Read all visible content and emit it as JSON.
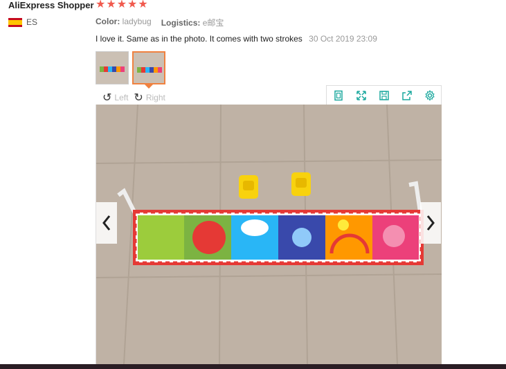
{
  "reviewer": {
    "name": "AliExpress Shopper",
    "rating": 5,
    "country": "ES"
  },
  "meta": {
    "color_label": "Color:",
    "color_value": "ladybug",
    "logistics_label": "Logistics:",
    "logistics_value": "e邮宝"
  },
  "review": {
    "text": "I love it. Same as in the photo. It comes with two strokes",
    "date": "30 Oct 2019 23:09"
  },
  "rotate": {
    "left_label": "Left",
    "right_label": "Right"
  },
  "colors": {
    "accent": "#f0813f",
    "star": "#f05a4e",
    "tool": "#1aa89e"
  }
}
